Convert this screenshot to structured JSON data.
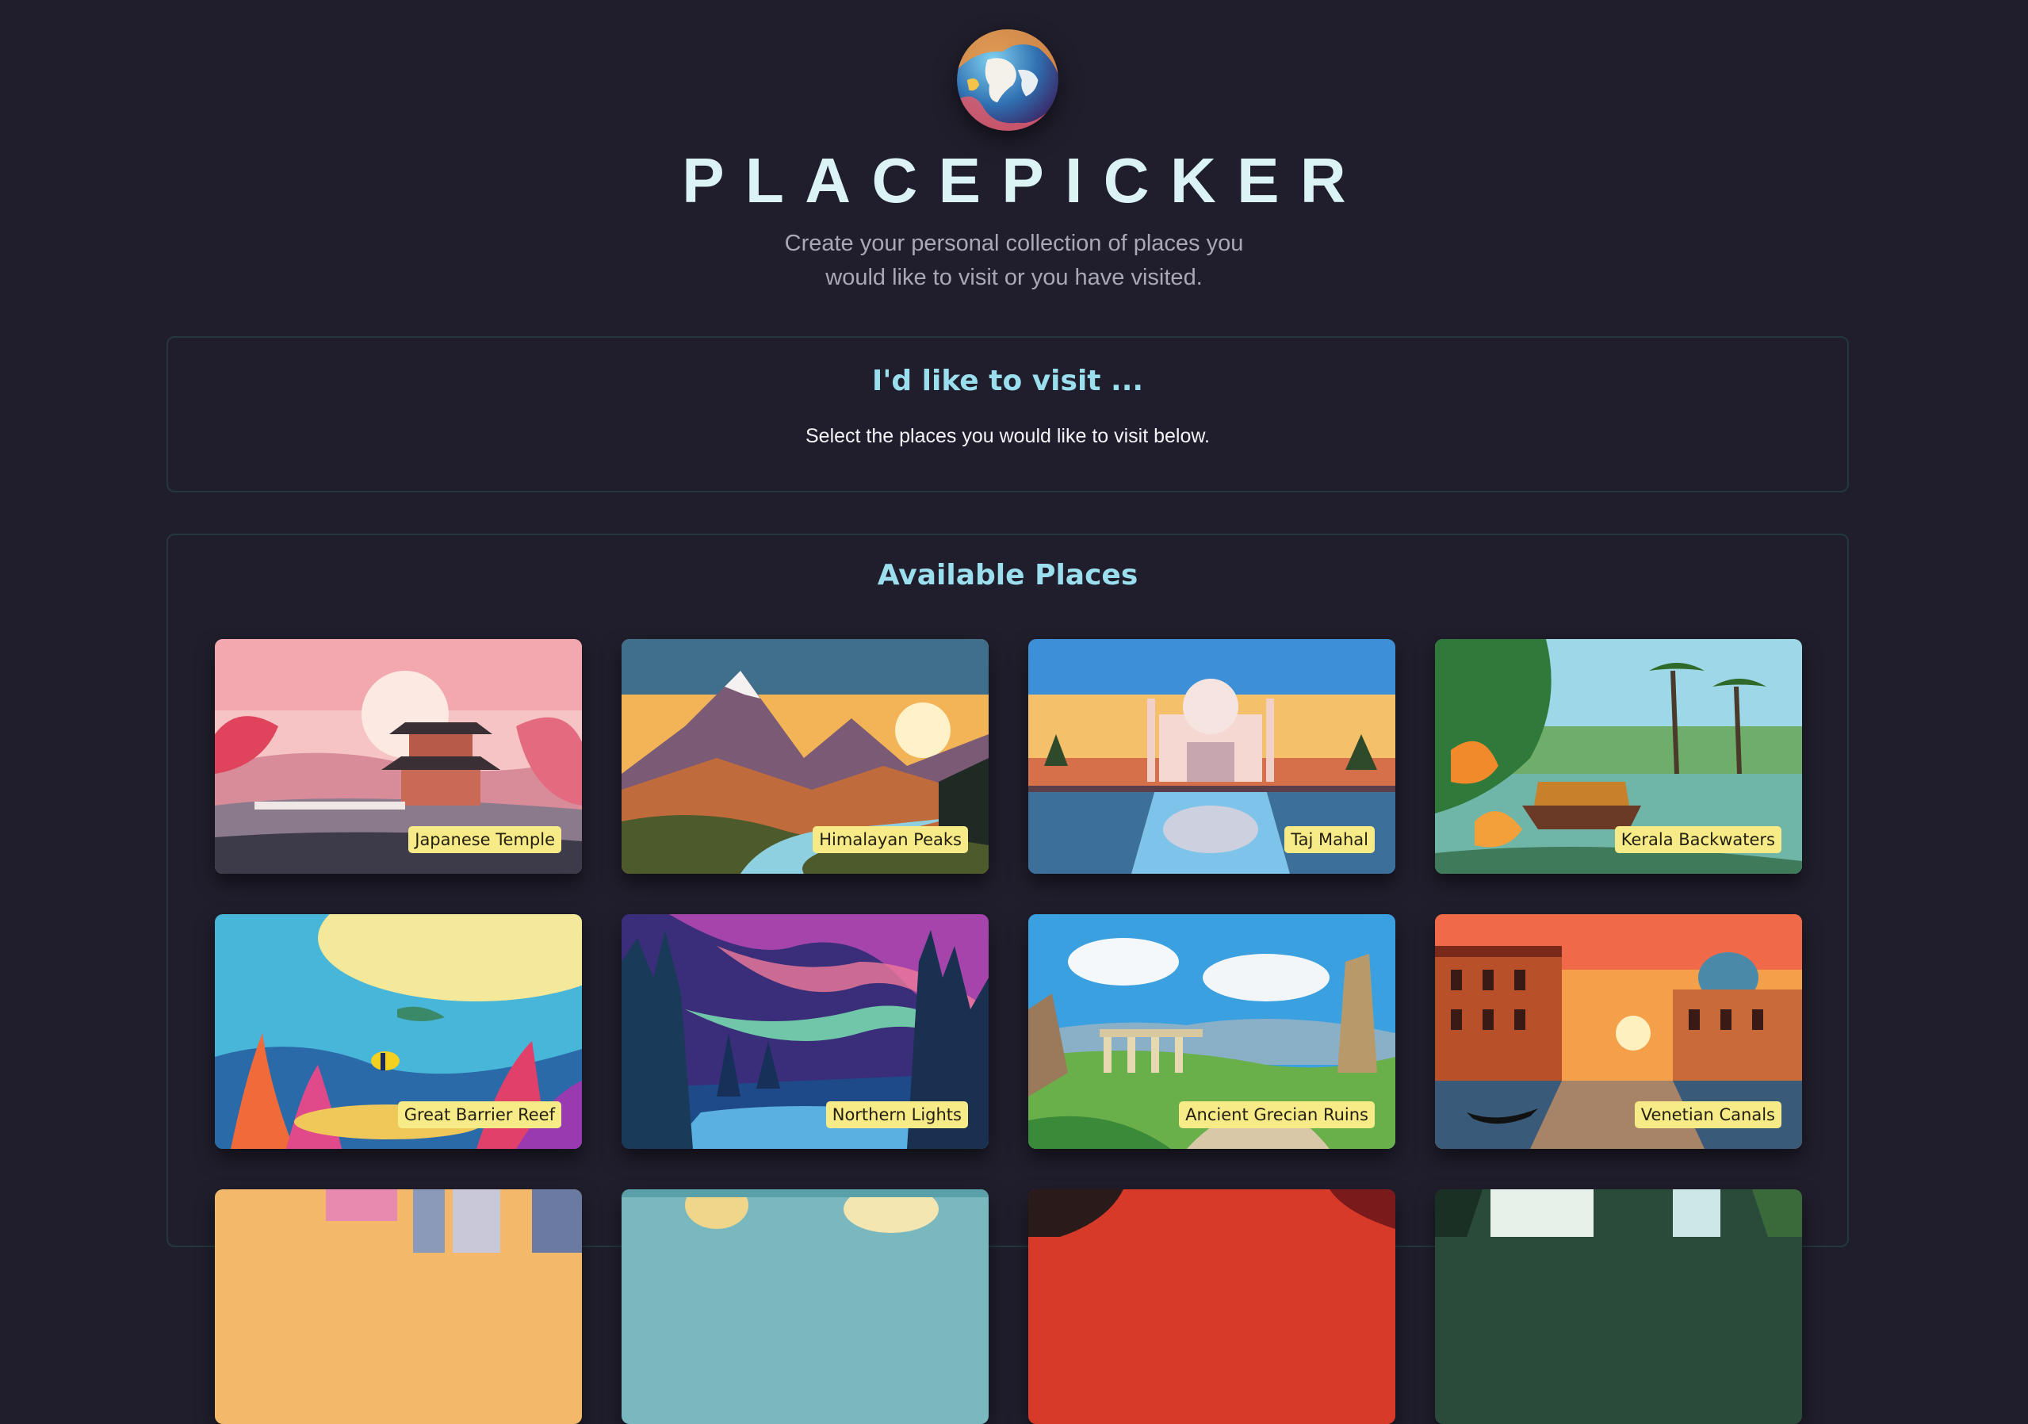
{
  "header": {
    "title": "PLACEPICKER",
    "subtitle_line1": "Create your personal collection of places you",
    "subtitle_line2": "would like to visit or you have visited.",
    "logo_icon": "globe-icon"
  },
  "visit_section": {
    "heading": "I'd like to visit ...",
    "empty_text": "Select the places you would like to visit below."
  },
  "available_section": {
    "heading": "Available Places",
    "places": [
      {
        "title": "Japanese Temple"
      },
      {
        "title": "Himalayan Peaks"
      },
      {
        "title": "Taj Mahal"
      },
      {
        "title": "Kerala Backwaters"
      },
      {
        "title": "Great Barrier Reef"
      },
      {
        "title": "Northern Lights"
      },
      {
        "title": "Ancient Grecian Ruins"
      },
      {
        "title": "Venetian Canals"
      }
    ]
  },
  "colors": {
    "background": "#201e2c",
    "title": "#dcf3f6",
    "heading_accent": "#9bdfee",
    "label_background": "#f6eb86",
    "panel_border": "#23383c"
  }
}
